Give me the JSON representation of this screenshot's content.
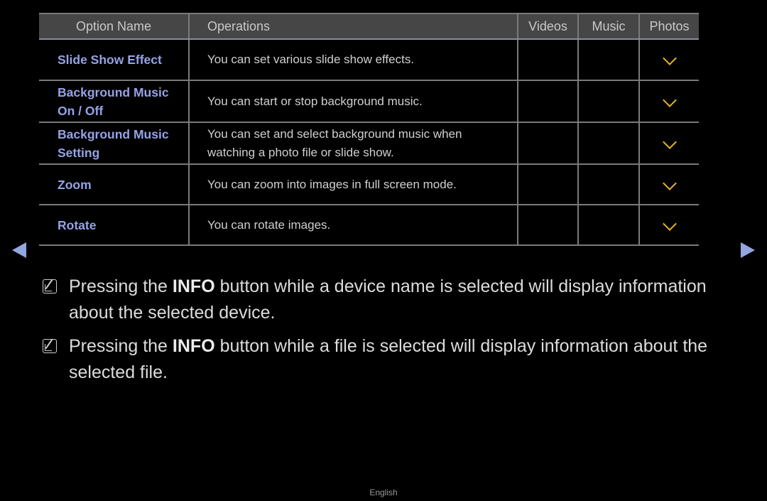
{
  "table": {
    "headers": [
      "Option Name",
      "Operations",
      "Videos",
      "Music",
      "Photos"
    ],
    "rows": [
      {
        "name": "Slide Show Effect",
        "operation": "You can set various slide show effects.",
        "videos": false,
        "music": false,
        "photos": true
      },
      {
        "name": "Background Music On / Off",
        "name_lines": [
          "Background  Music",
          "On / Off"
        ],
        "operation": "You can start or stop background music.",
        "videos": false,
        "music": false,
        "photos": true
      },
      {
        "name": "Background Music Setting",
        "name_lines": [
          "Background Music",
          "Setting"
        ],
        "operation": "You can set and select background music when watching a photo file or slide show.",
        "op_lines": [
          "You can set and select background music when",
          "watching a photo file or slide show."
        ],
        "videos": false,
        "music": false,
        "photos": true
      },
      {
        "name": "Zoom",
        "operation": "You can zoom into images in full screen mode.",
        "videos": false,
        "music": false,
        "photos": true
      },
      {
        "name": "Rotate",
        "operation": "You can rotate images.",
        "videos": false,
        "music": false,
        "photos": true
      }
    ],
    "check_icon": "check-icon",
    "check_color": "#e8b32a",
    "name_color": "#95a3e6"
  },
  "nav": {
    "prev_icon": "triangle-left-icon",
    "next_icon": "triangle-right-icon",
    "arrow_color": "#93a6e0"
  },
  "notes": [
    {
      "icon": "note-icon",
      "before": "Pressing the ",
      "bold": "INFO",
      "after": " button while a device name is selected will display information about the selected device."
    },
    {
      "icon": "note-icon",
      "before": "Pressing the ",
      "bold": "INFO",
      "after": " button while a file is selected will display information about the selected file."
    }
  ],
  "footer": {
    "language": "English"
  }
}
